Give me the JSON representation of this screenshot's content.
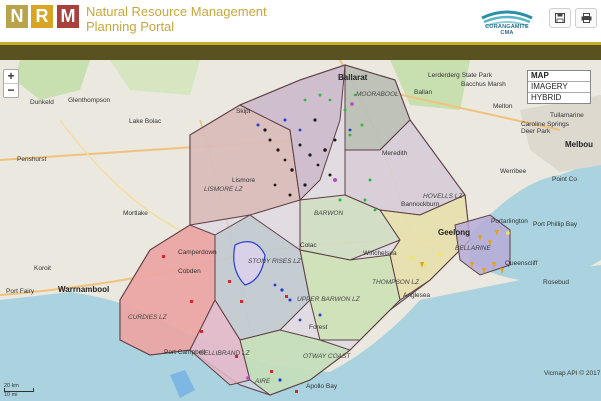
{
  "header": {
    "logo_letters": [
      "N",
      "R",
      "M"
    ],
    "logo_colors": [
      "#b9a44c",
      "#d9a623",
      "#a9403b"
    ],
    "title_line1": "Natural Resource Management",
    "title_line2": "Planning Portal",
    "partner_logo_text": "CORANGAMITE CMA",
    "save_icon": "save-icon",
    "print_icon": "print-icon",
    "accent_color": "#c9ae2e",
    "band_color": "#5a5121"
  },
  "map": {
    "zoom_in": "+",
    "zoom_out": "−",
    "layers": [
      "MAP",
      "IMAGERY",
      "HYBRID"
    ],
    "active_layer": "MAP",
    "places": {
      "ballarat": "Ballarat",
      "lerderderg": "Lerderderg State Park",
      "ballan": "Ballan",
      "bacchus_marsh": "Bacchus Marsh",
      "melton": "Melton",
      "caroline_springs": "Caroline Springs",
      "deer_park": "Deer Park",
      "tullamarine": "Tullamarine",
      "melbourne": "Melbou",
      "dunkeld": "Dunkeld",
      "glenthompson": "Glenthompson",
      "lake_bolac": "Lake Bolac",
      "skipton": "Skipt",
      "penshurst": "Penshurst",
      "mortlake": "Mortlake",
      "lismore": "Lismore",
      "meredith": "Meredith",
      "bannockburn": "Bannockburn",
      "werribee": "Werribee",
      "point_cook": "Point Co",
      "portarlington": "Portarlington",
      "port_phillip_bay": "Port Phillip Bay",
      "geelong": "Geelong",
      "queenscliff": "Queenscliff",
      "rosebud": "Rosebud",
      "camperdown": "Camperdown",
      "cobden": "Cobden",
      "koroit": "Koroit",
      "port_fairy": "Port Fairy",
      "warrnambool": "Warrnambool",
      "winchelsea": "Winchelsea",
      "anglesea": "Anglesea",
      "forest": "Forest",
      "colac": "Colac",
      "port_campbell": "Port Campbell",
      "apollo_bay": "Apollo Bay",
      "moorabool_lz": "MOORABOOL",
      "hovells_lz": "HOVELLS LZ",
      "lismore_lz": "LISMORE LZ",
      "barwon_lz": "BARWON",
      "bellarine_lz": "BELLARINE",
      "stony_rises_lz": "STONY RISES LZ",
      "upper_barwon_lz": "UPPER BARWON LZ",
      "thompson_lz": "THOMPSON LZ",
      "curdies_lz": "CURDIES LZ",
      "gellibrand_lz": "GELLIBRAND LZ",
      "otway_coast_lz": "OTWAY COAST",
      "aire_lz": "AIRE"
    },
    "scale_km": "20 km",
    "scale_mi": "10 mi",
    "attribution": "Vicmap API © 2017"
  }
}
